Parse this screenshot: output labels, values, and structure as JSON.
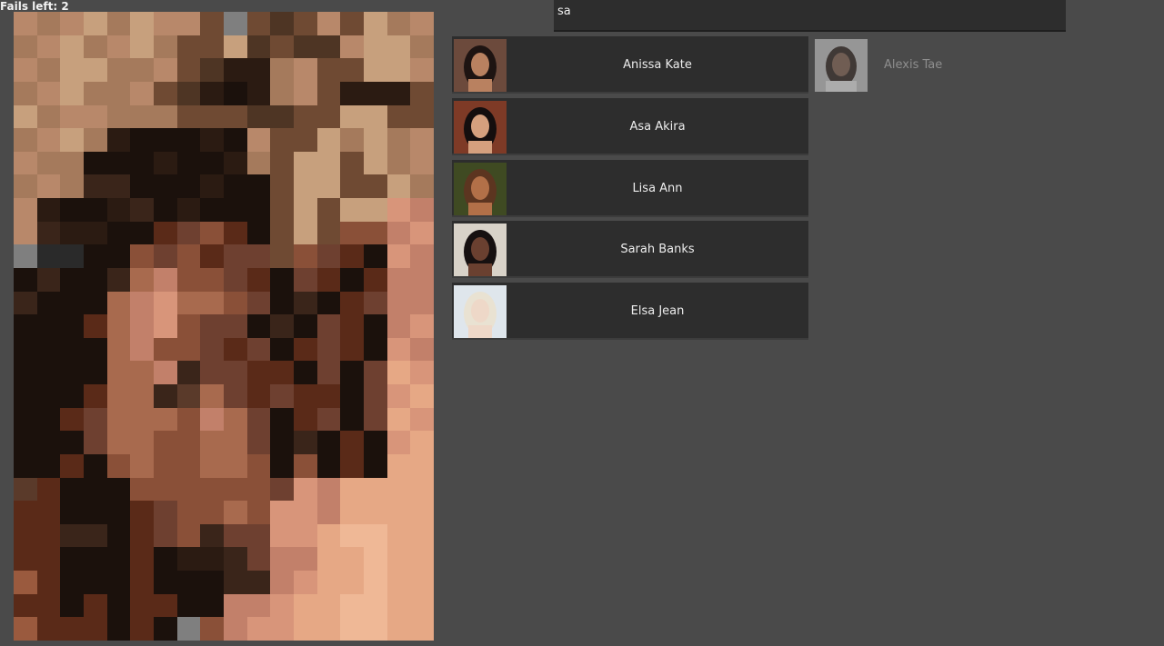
{
  "game": {
    "fails_label": "Fails left: 2"
  },
  "search": {
    "value": "sa"
  },
  "results": [
    {
      "name": "Anissa Kate",
      "skin": "#b98160",
      "hair": "#1e1412",
      "bg": "#6c4a3c"
    },
    {
      "name": "Asa Akira",
      "skin": "#d5a07e",
      "hair": "#140e0e",
      "bg": "#7e3a26"
    },
    {
      "name": "Lisa Ann",
      "skin": "#b27048",
      "hair": "#5c3520",
      "bg": "#3f4a22"
    },
    {
      "name": "Sarah Banks",
      "skin": "#6a4030",
      "hair": "#161010",
      "bg": "#d8d2c8"
    },
    {
      "name": "Elsa Jean",
      "skin": "#eed8c8",
      "hair": "#e9e2d2",
      "bg": "#dfe6ec"
    }
  ],
  "previous_guess": {
    "name": "Alexis Tae",
    "skin": "#8a6a5a",
    "hair": "#3a2e2a",
    "bg": "#c9c9c9"
  },
  "mosaic": {
    "cols": 18,
    "rows": 27,
    "palette": {
      "a": "#b8886a",
      "b": "#a57a5c",
      "c": "#c7a07d",
      "d": "#6f4a33",
      "e": "#4e3524",
      "f": "#2b1b12",
      "g": "#1b110c",
      "h": "#3a251a",
      "i": "#5a3a2a",
      "j": "#6e4030",
      "k": "#8a5038",
      "l": "#a86a4e",
      "m": "#c2806a",
      "n": "#d8957a",
      "o": "#e6a885",
      "p": "#efb896",
      "q": "#7f7f7f",
      "r": "#2a2a2a",
      "s": "#5a2a18",
      "t": "#9a5a3e"
    },
    "cells": [
      "abacbcaadqdedadcba",
      "bacbacbddcedeeaccb",
      "abccbbadeffbaddcca",
      "bacbbadefgfbadfffd",
      "cbaabbbdddeeddccdd",
      "bacbfgggfgaddcbcba",
      "abbgggfggfbdccdcba",
      "babhhgggfggdccddcb",
      "afggfhgfgggdcdccnm",
      "ahffggsjksgdcdkkmn",
      "qrrggkjksjjdkjsgnm",
      "ghgghlmkkjsgjsgsmm",
      "hggglmnllkjghgsjmm",
      "gggslmnkjjghgjsgmn",
      "gggglmkkjsjgsjsgnm",
      "ggggllmhjjssgjgjon",
      "gggsllhiljsjssgjno",
      "ggsjlllkmljgsjgjon",
      "gggjllkklljghgsgno",
      "ggsgklkkllkgkgsgoo",
      "isgggkkkkkkjnmoooo",
      "ssgggsjkklknnmoooo",
      "sshhgsjkhjjnnoppoo",
      "ssgggsgffhjmmoopoo",
      "tsgggsggghhmnoopoo",
      "ssgsgssggmmnooppoo",
      "tsssgsgqkmnnooppoo"
    ]
  }
}
